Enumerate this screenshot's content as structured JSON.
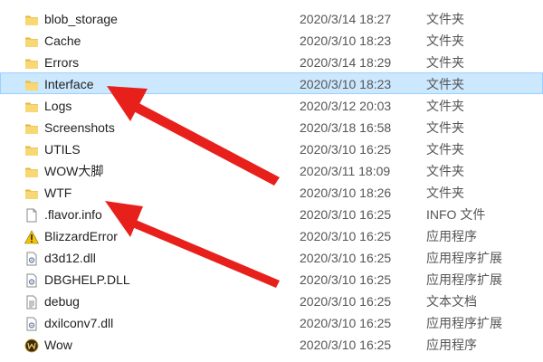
{
  "files": [
    {
      "name": "blob_storage",
      "date": "2020/3/14 18:27",
      "type": "文件夹",
      "icon": "folder-icon",
      "selected": false
    },
    {
      "name": "Cache",
      "date": "2020/3/10 18:23",
      "type": "文件夹",
      "icon": "folder-icon",
      "selected": false
    },
    {
      "name": "Errors",
      "date": "2020/3/14 18:29",
      "type": "文件夹",
      "icon": "folder-icon",
      "selected": false
    },
    {
      "name": "Interface",
      "date": "2020/3/10 18:23",
      "type": "文件夹",
      "icon": "folder-icon",
      "selected": true
    },
    {
      "name": "Logs",
      "date": "2020/3/12 20:03",
      "type": "文件夹",
      "icon": "folder-icon",
      "selected": false
    },
    {
      "name": "Screenshots",
      "date": "2020/3/18 16:58",
      "type": "文件夹",
      "icon": "folder-icon",
      "selected": false
    },
    {
      "name": "UTILS",
      "date": "2020/3/10 16:25",
      "type": "文件夹",
      "icon": "folder-icon",
      "selected": false
    },
    {
      "name": "WOW大脚",
      "date": "2020/3/11 18:09",
      "type": "文件夹",
      "icon": "folder-icon",
      "selected": false
    },
    {
      "name": "WTF",
      "date": "2020/3/10 18:26",
      "type": "文件夹",
      "icon": "folder-icon",
      "selected": false
    },
    {
      "name": ".flavor.info",
      "date": "2020/3/10 16:25",
      "type": "INFO 文件",
      "icon": "file-icon",
      "selected": false
    },
    {
      "name": "BlizzardError",
      "date": "2020/3/10 16:25",
      "type": "应用程序",
      "icon": "warning-icon",
      "selected": false
    },
    {
      "name": "d3d12.dll",
      "date": "2020/3/10 16:25",
      "type": "应用程序扩展",
      "icon": "dll-file-icon",
      "selected": false
    },
    {
      "name": "DBGHELP.DLL",
      "date": "2020/3/10 16:25",
      "type": "应用程序扩展",
      "icon": "dll-file-icon",
      "selected": false
    },
    {
      "name": "debug",
      "date": "2020/3/10 16:25",
      "type": "文本文档",
      "icon": "text-file-icon",
      "selected": false
    },
    {
      "name": "dxilconv7.dll",
      "date": "2020/3/10 16:25",
      "type": "应用程序扩展",
      "icon": "dll-file-icon",
      "selected": false
    },
    {
      "name": "Wow",
      "date": "2020/3/10 16:25",
      "type": "应用程序",
      "icon": "wow-app-icon",
      "selected": false
    }
  ],
  "colors": {
    "selection_bg": "#cce8ff",
    "selection_border": "#99d1ff",
    "folder": "#f8d775",
    "annotation_arrow": "#e8201c"
  }
}
